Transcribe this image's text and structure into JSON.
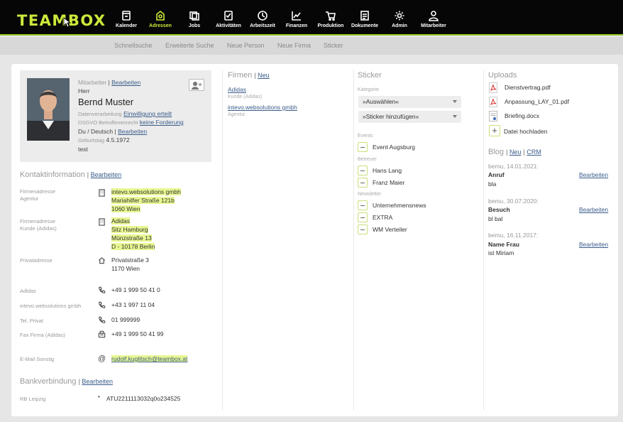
{
  "app": {
    "logo": "TEAMBOX"
  },
  "nav": [
    {
      "label": "Kalender",
      "icon": "calendar-icon",
      "active": false
    },
    {
      "label": "Adressen",
      "icon": "address-book-icon",
      "active": true
    },
    {
      "label": "Jobs",
      "icon": "jobs-icon",
      "active": false
    },
    {
      "label": "Aktivitäten",
      "icon": "activity-icon",
      "active": false
    },
    {
      "label": "Arbeitszeit",
      "icon": "clock-icon",
      "active": false
    },
    {
      "label": "Finanzen",
      "icon": "chart-icon",
      "active": false
    },
    {
      "label": "Produktion",
      "icon": "cart-icon",
      "active": false
    },
    {
      "label": "Dokumente",
      "icon": "documents-icon",
      "active": false
    },
    {
      "label": "Admin",
      "icon": "gear-icon",
      "active": false
    },
    {
      "label": "Mitarbeiter",
      "icon": "user-icon",
      "active": false
    }
  ],
  "subnav": [
    "Schnellsuche",
    "Erweiterte Suche",
    "Neue Person",
    "Neue Firma",
    "Sticker"
  ],
  "profile": {
    "role": "Mitarbeiter",
    "edit": "Bearbeiten",
    "salutation": "Herr",
    "name": "Bernd Muster",
    "data_processing_label": "Datenverarbeitung",
    "data_processing_link": "Einwilligung erteilt",
    "gdpr_label": "DSGVO Betroffenenrecht",
    "gdpr_link": "keine Forderung",
    "language": "Du / Deutsch |",
    "language_edit": "Bearbeiten",
    "birthday_label": "Geburtstag",
    "birthday": "4.5.1972",
    "note": "test"
  },
  "contact": {
    "title": "Kontaktinformation",
    "edit": "Bearbeiten",
    "company_address_1": {
      "label1": "Firmenadresse",
      "label2": "Agentur",
      "lines": [
        "intevo.websolutions gmbh",
        "Mariahilfer Straße 121b",
        "1060 Wien"
      ]
    },
    "company_address_2": {
      "label1": "Firmenadresse",
      "label2": "Kunde (Adidas)",
      "lines": [
        "Adidas",
        "Sitz Hamburg",
        "Münzstraße 13",
        "D - 10178 Berlin"
      ]
    },
    "private_address": {
      "label": "Privatadresse",
      "lines": [
        "Privatstraße 3",
        "1170 Wien"
      ]
    },
    "phones": [
      {
        "label": "Adidas",
        "value": "+49 1 999 50 41 0",
        "icon": "phone-icon"
      },
      {
        "label": "intevo.websolutions gmbh",
        "value": "+43 1 997 11 04",
        "icon": "phone-icon"
      },
      {
        "label": "Tel. Privat",
        "value": "01 999999",
        "icon": "phone-icon"
      },
      {
        "label": "Fax Firma (Adidas)",
        "value": "+49 1 999 50 41 99",
        "icon": "fax-icon"
      }
    ],
    "email": {
      "label": "E-Mail Sonstig",
      "value": "rudolf.kuglitsch@teambox.at"
    }
  },
  "bank": {
    "title": "Bankverbindung",
    "edit": "Bearbeiten",
    "label": "RB Leipzig",
    "value": "ATU2211113032q0o234525"
  },
  "firmen": {
    "title": "Firmen",
    "new": "Neu",
    "items": [
      {
        "name": "Adidas",
        "sub": "Kunde (Adidas)"
      },
      {
        "name": "intevo.websolutions gmbh",
        "sub": "Agentur"
      }
    ]
  },
  "sticker": {
    "title": "Sticker",
    "category_label": "Kategorie",
    "select_1": "»Auswählen«",
    "select_2": "»Sticker hinzufügen«",
    "groups": [
      {
        "label": "Events",
        "items": [
          "Event Augsburg"
        ]
      },
      {
        "label": "Betreuer",
        "items": [
          "Hans Lang",
          "Franz Maier"
        ]
      },
      {
        "label": "Newsletter",
        "items": [
          "Unternehmensnews",
          "EXTRA",
          "WM Verteiler"
        ]
      }
    ]
  },
  "uploads": {
    "title": "Uploads",
    "files": [
      {
        "name": "Dienstvertrag.pdf",
        "type": "pdf"
      },
      {
        "name": "Anpassung_LAY_01.pdf",
        "type": "pdf"
      },
      {
        "name": "Briefing.docx",
        "type": "doc"
      }
    ],
    "upload_label": "Datei hochladen"
  },
  "blog": {
    "title": "Blog",
    "new": "Neu",
    "crm": "CRM",
    "entries": [
      {
        "date": "bemu, 14.01.2021:",
        "title": "Anruf",
        "text": "bla",
        "edit": "Bearbeiten"
      },
      {
        "date": "bemu, 30.07.2020:",
        "title": "Besuch",
        "text": "bl bal",
        "edit": "Bearbeiten"
      },
      {
        "date": "bemu, 16.11.2017:",
        "title": "Name Frau",
        "text": "ist Miriam",
        "edit": "Bearbeiten"
      }
    ]
  }
}
